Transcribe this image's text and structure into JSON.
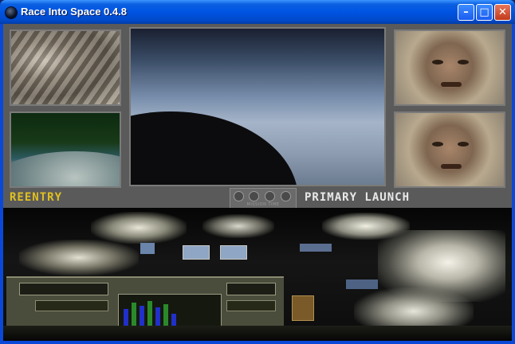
{
  "window": {
    "title": "Race Into Space 0.4.8",
    "buttons": {
      "minimize": "–",
      "maximize": "□",
      "close": "✕"
    }
  },
  "hud": {
    "left_label": "REENTRY",
    "right_label": "PRIMARY LAUNCH",
    "timer_caption": "MISSION TIME"
  },
  "colors": {
    "reentry_label": "#e0c020",
    "launch_label": "#e8e8e8",
    "console_gray": "#5a5a5a"
  },
  "icons": [
    "app-icon",
    "minimize-icon",
    "maximize-icon",
    "close-icon"
  ]
}
